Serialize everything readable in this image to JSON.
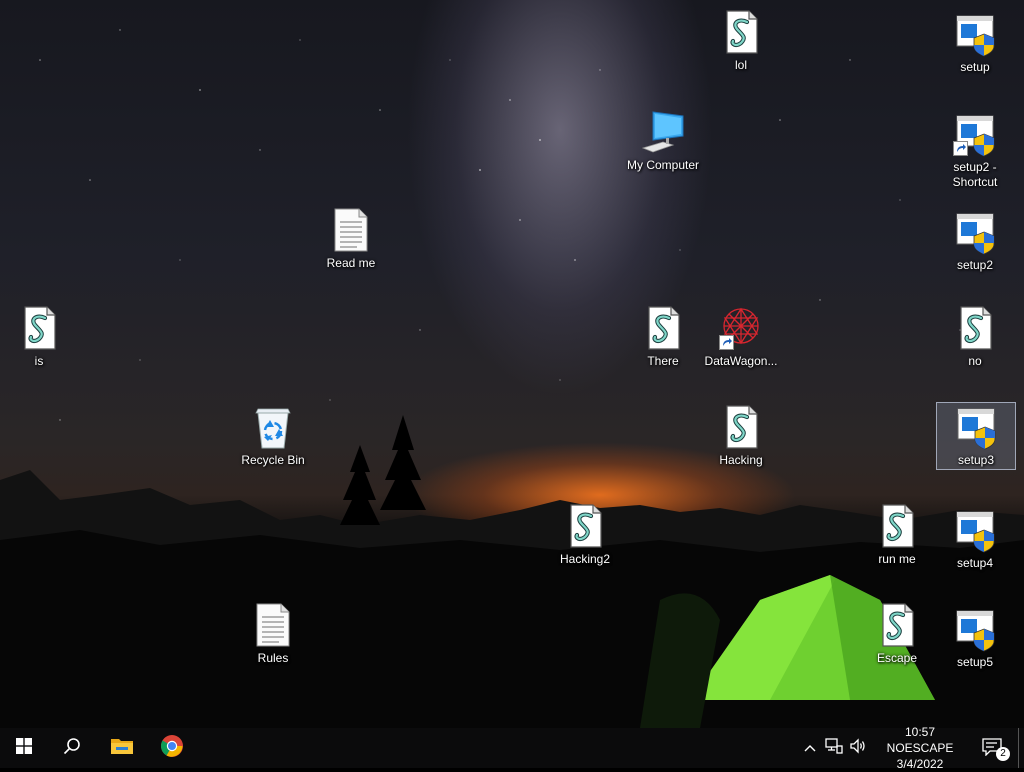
{
  "desktop": {
    "icons": [
      {
        "id": "lol",
        "label": "lol",
        "type": "script"
      },
      {
        "id": "setup",
        "label": "setup",
        "type": "installer"
      },
      {
        "id": "my-computer",
        "label": "My Computer",
        "type": "computer"
      },
      {
        "id": "setup2-shortcut",
        "label": "setup2 - Shortcut",
        "type": "installer-shortcut"
      },
      {
        "id": "read-me",
        "label": "Read me",
        "type": "text"
      },
      {
        "id": "setup2",
        "label": "setup2",
        "type": "installer"
      },
      {
        "id": "is",
        "label": "is",
        "type": "script"
      },
      {
        "id": "there",
        "label": "There",
        "type": "script"
      },
      {
        "id": "datawagon",
        "label": "DataWagon...",
        "type": "app-shortcut"
      },
      {
        "id": "no",
        "label": "no",
        "type": "script"
      },
      {
        "id": "recycle-bin",
        "label": "Recycle Bin",
        "type": "recycle-bin"
      },
      {
        "id": "hacking",
        "label": "Hacking",
        "type": "script"
      },
      {
        "id": "setup3",
        "label": "setup3",
        "type": "installer",
        "selected": true
      },
      {
        "id": "hacking2",
        "label": "Hacking2",
        "type": "script"
      },
      {
        "id": "run-me",
        "label": "run me",
        "type": "script"
      },
      {
        "id": "setup4",
        "label": "setup4",
        "type": "installer"
      },
      {
        "id": "rules",
        "label": "Rules",
        "type": "text"
      },
      {
        "id": "escape",
        "label": "Escape",
        "type": "script"
      },
      {
        "id": "setup5",
        "label": "setup5",
        "type": "installer"
      }
    ]
  },
  "taskbar": {
    "start_icon": "windows-logo-icon",
    "search_icon": "search-icon",
    "pinned": [
      {
        "id": "file-explorer",
        "icon": "folder-icon"
      },
      {
        "id": "chrome",
        "icon": "chrome-icon"
      }
    ],
    "tray": {
      "time": "10:57 NOESCAPE",
      "date": "3/4/2022",
      "notification_count": "2"
    }
  }
}
